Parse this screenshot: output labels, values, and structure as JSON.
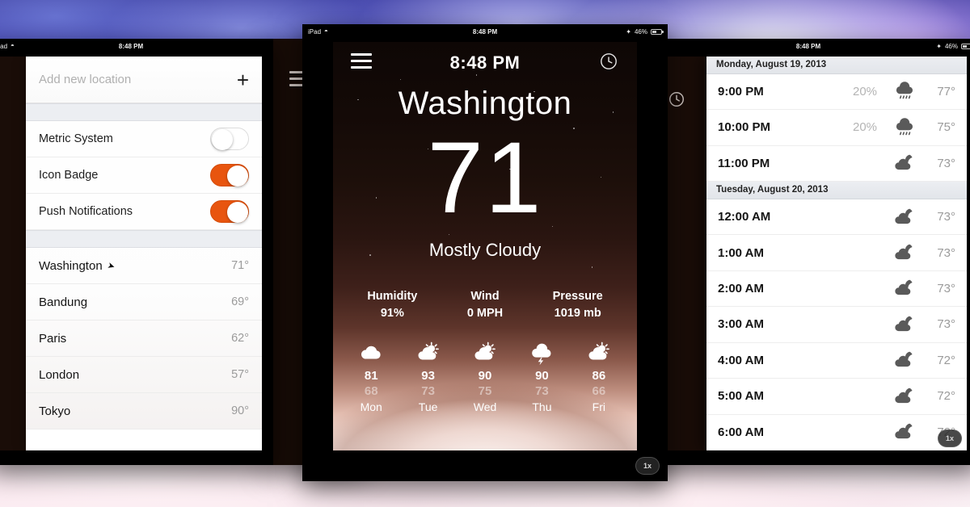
{
  "status_bar": {
    "carrier": "iPad",
    "wifi_icon": "wifi-icon",
    "time": "8:48 PM",
    "battery_percent": "46%",
    "battery_icon": "battery-icon"
  },
  "status_bar_left_panel": {
    "carrier": "iPad",
    "time": "8:48 PM"
  },
  "settings_panel": {
    "add_location_placeholder": "Add new location",
    "add_icon": "plus-icon",
    "toggles": [
      {
        "label": "Metric System",
        "on": false
      },
      {
        "label": "Icon Badge",
        "on": true
      },
      {
        "label": "Push Notifications",
        "on": true
      }
    ],
    "locations": [
      {
        "name": "Washington",
        "temp": "71°",
        "current_location": true
      },
      {
        "name": "Bandung",
        "temp": "69°",
        "current_location": false
      },
      {
        "name": "Paris",
        "temp": "62°",
        "current_location": false
      },
      {
        "name": "London",
        "temp": "57°",
        "current_location": false
      },
      {
        "name": "Tokyo",
        "temp": "90°",
        "current_location": false
      }
    ]
  },
  "main_panel": {
    "menu_icon": "hamburger-menu-icon",
    "time": "8:48 PM",
    "clock_icon": "clock-icon",
    "city": "Washington",
    "temperature": "71",
    "condition": "Mostly Cloudy",
    "metrics": [
      {
        "label": "Humidity",
        "value": "91%"
      },
      {
        "label": "Wind",
        "value": "0 MPH"
      },
      {
        "label": "Pressure",
        "value": "1019 mb"
      }
    ],
    "forecast": [
      {
        "day": "Mon",
        "icon": "cloudy-icon",
        "high": "81",
        "low": "68"
      },
      {
        "day": "Tue",
        "icon": "partly-sunny-icon",
        "high": "93",
        "low": "73"
      },
      {
        "day": "Wed",
        "icon": "partly-sunny-icon",
        "high": "90",
        "low": "75"
      },
      {
        "day": "Thu",
        "icon": "thunderstorm-icon",
        "high": "90",
        "low": "73"
      },
      {
        "day": "Fri",
        "icon": "partly-sunny-icon",
        "high": "86",
        "low": "66"
      }
    ],
    "scale_badge": "1x"
  },
  "hourly_panel": {
    "clock_icon": "clock-icon",
    "scale_badge": "1x",
    "groups": [
      {
        "date": "Monday, August 19, 2013",
        "rows": [
          {
            "time": "9:00 PM",
            "pop": "20%",
            "icon": "rain-icon",
            "temp": "77°"
          },
          {
            "time": "10:00 PM",
            "pop": "20%",
            "icon": "rain-icon",
            "temp": "75°"
          },
          {
            "time": "11:00 PM",
            "pop": "",
            "icon": "night-cloudy-icon",
            "temp": "73°"
          }
        ]
      },
      {
        "date": "Tuesday, August 20, 2013",
        "rows": [
          {
            "time": "12:00 AM",
            "pop": "",
            "icon": "night-cloudy-icon",
            "temp": "73°"
          },
          {
            "time": "1:00 AM",
            "pop": "",
            "icon": "night-cloudy-icon",
            "temp": "73°"
          },
          {
            "time": "2:00 AM",
            "pop": "",
            "icon": "night-cloudy-icon",
            "temp": "73°"
          },
          {
            "time": "3:00 AM",
            "pop": "",
            "icon": "night-cloudy-icon",
            "temp": "73°"
          },
          {
            "time": "4:00 AM",
            "pop": "",
            "icon": "night-cloudy-icon",
            "temp": "72°"
          },
          {
            "time": "5:00 AM",
            "pop": "",
            "icon": "night-cloudy-icon",
            "temp": "72°"
          },
          {
            "time": "6:00 AM",
            "pop": "",
            "icon": "night-cloudy-icon",
            "temp": "72°"
          }
        ]
      }
    ]
  },
  "colors": {
    "accent_orange": "#e8550f",
    "panel_white": "#ffffff",
    "muted_text": "#9b9b9b",
    "day_header_bg": "#eceef2"
  }
}
